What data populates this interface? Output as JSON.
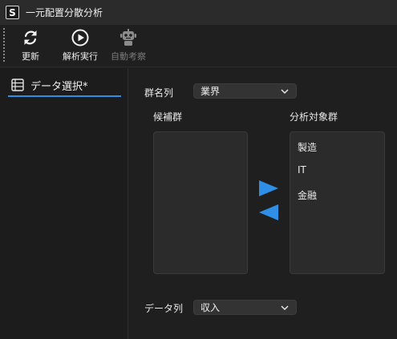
{
  "window": {
    "app_icon_letter": "S",
    "title": "一元配置分散分析"
  },
  "toolbar": {
    "refresh_label": "更新",
    "run_label": "解析実行",
    "auto_label": "自動考察"
  },
  "sidebar": {
    "items": [
      {
        "label": "データ選択*",
        "selected": true
      }
    ]
  },
  "form": {
    "group_column_label": "群名列",
    "group_column_value": "業界",
    "candidates_label": "候補群",
    "targets_label": "分析対象群",
    "candidates": [],
    "targets": [
      "製造",
      "IT",
      "金融"
    ],
    "data_column_label": "データ列",
    "data_column_value": "収入"
  },
  "colors": {
    "accent": "#2f8fe6",
    "arrow": "#2f8fe6"
  }
}
